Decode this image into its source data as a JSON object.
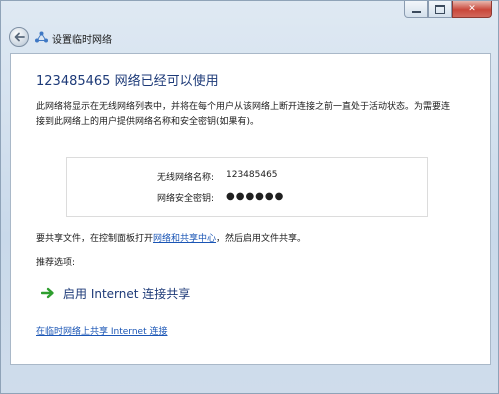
{
  "window": {
    "title": "设置临时网络",
    "caption": {
      "minimize": "",
      "maximize": "",
      "close": "✕"
    }
  },
  "main": {
    "heading": "123485465 网络已经可以使用",
    "description": "此网络将显示在无线网络列表中，并将在每个用户从该网络上断开连接之前一直处于活动状态。为需要连接到此网络上的用户提供网络名称和安全密钥(如果有)。",
    "network_info": {
      "name_label": "无线网络名称:",
      "name_value": "123485465",
      "key_label": "网络安全密钥:",
      "key_value": "●●●●●●"
    },
    "share": {
      "prefix": "要共享文件，在控制面板打开",
      "link": "网络和共享中心",
      "suffix": "，然后启用文件共享。"
    },
    "recommended_label": "推荐选项:",
    "command_link": "启用 Internet 连接共享",
    "bottom_link": "在临时网络上共享 Internet 连接"
  },
  "colors": {
    "heading": "#1d3a78",
    "link": "#1a55b5",
    "arrow": "#2e9e2e"
  },
  "icons": [
    "back-arrow-icon",
    "network-icon",
    "green-arrow-icon"
  ]
}
